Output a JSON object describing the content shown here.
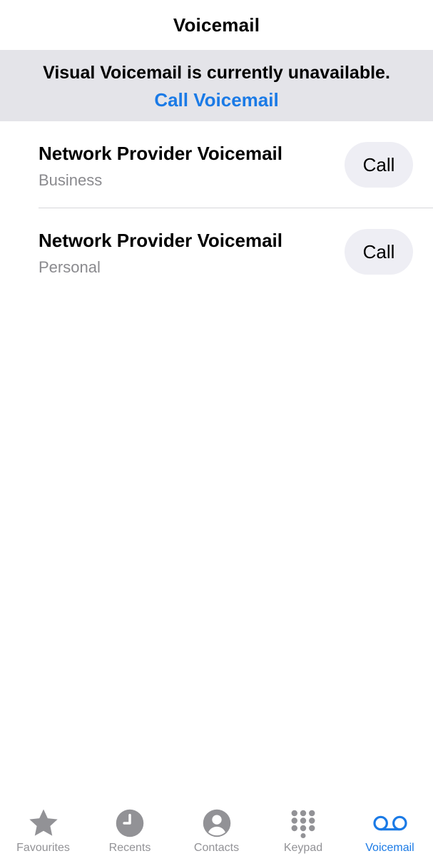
{
  "theme": {
    "accent": "#1a7ae6",
    "inactive_tab": "#929296",
    "banner_bg": "#e4e4e9"
  },
  "nav": {
    "title": "Voicemail"
  },
  "banner": {
    "message": "Visual Voicemail is currently unavailable.",
    "link": "Call Voicemail"
  },
  "voicemails": [
    {
      "title": "Network Provider Voicemail",
      "subtitle": "Business",
      "button": "Call"
    },
    {
      "title": "Network Provider Voicemail",
      "subtitle": "Personal",
      "button": "Call"
    }
  ],
  "tabs": [
    {
      "label": "Favourites",
      "icon": "star-icon",
      "active": false
    },
    {
      "label": "Recents",
      "icon": "clock-icon",
      "active": false
    },
    {
      "label": "Contacts",
      "icon": "person-circle-icon",
      "active": false
    },
    {
      "label": "Keypad",
      "icon": "keypad-icon",
      "active": false
    },
    {
      "label": "Voicemail",
      "icon": "voicemail-icon",
      "active": true
    }
  ]
}
